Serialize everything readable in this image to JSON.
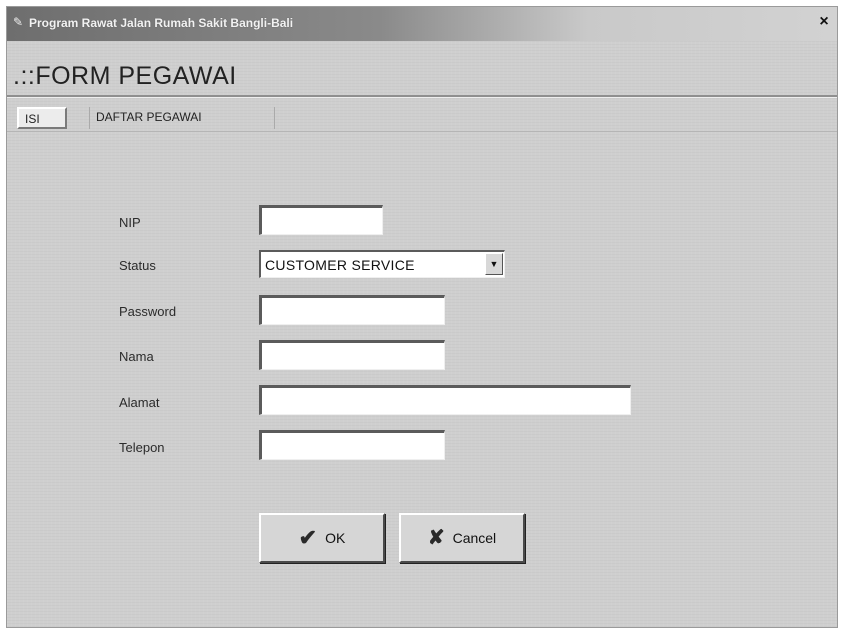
{
  "window": {
    "title": "Program Rawat Jalan Rumah Sakit Bangli-Bali",
    "close_glyph": "×",
    "app_icon": "app-icon"
  },
  "header": {
    "title": ".::FORM PEGAWAI"
  },
  "tabs": [
    {
      "label": "ISI",
      "active": true
    },
    {
      "label": "DAFTAR PEGAWAI",
      "active": false
    }
  ],
  "form": {
    "nip": {
      "label": "NIP",
      "value": ""
    },
    "status": {
      "label": "Status",
      "value": "CUSTOMER SERVICE",
      "icon": "chevron-down-icon"
    },
    "password": {
      "label": "Password",
      "value": ""
    },
    "nama": {
      "label": "Nama",
      "value": ""
    },
    "alamat": {
      "label": "Alamat",
      "value": ""
    },
    "telepon": {
      "label": "Telepon",
      "value": ""
    }
  },
  "buttons": {
    "ok": {
      "label": "OK",
      "icon": "check-icon"
    },
    "cancel": {
      "label": "Cancel",
      "icon": "x-icon"
    }
  }
}
